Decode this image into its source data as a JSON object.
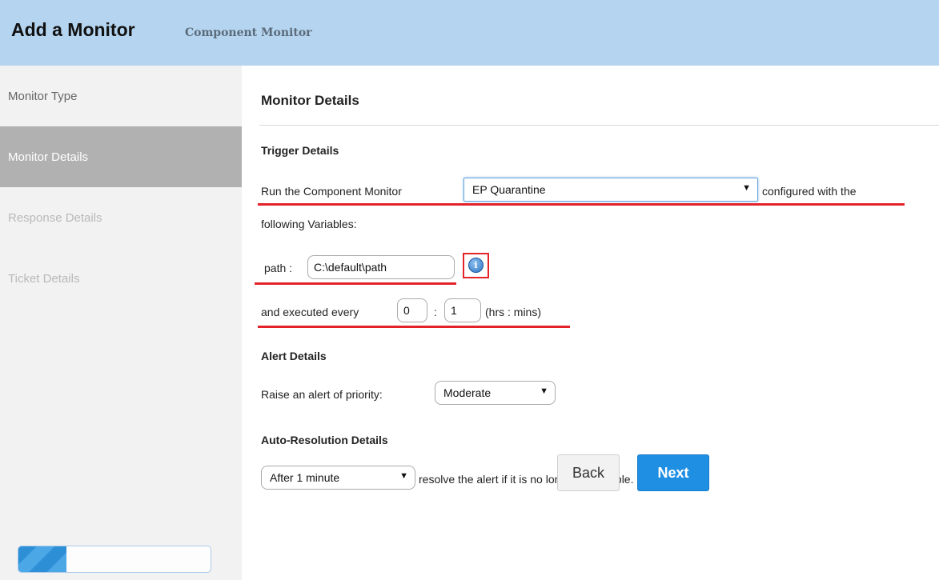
{
  "header": {
    "title": "Add a Monitor",
    "subtitle": "Component Monitor"
  },
  "sidebar": {
    "items": [
      {
        "label": "Monitor Type",
        "state": "done"
      },
      {
        "label": "Monitor Details",
        "state": "active"
      },
      {
        "label": "Response Details",
        "state": "pending"
      },
      {
        "label": "Ticket Details",
        "state": "pending"
      }
    ],
    "progress_fraction": 0.25
  },
  "main": {
    "title": "Monitor Details",
    "trigger": {
      "heading": "Trigger Details",
      "run_prefix": "Run the Component Monitor",
      "component_value": "EP Quarantine",
      "run_suffix": "configured with the",
      "run_line2": "following Variables:",
      "path_label": "path :",
      "path_value": "C:\\default\\path",
      "info_icon": "info-icon",
      "exec_prefix": "and executed every",
      "hours_value": "0",
      "colon": ":",
      "minutes_value": "1",
      "exec_suffix": "(hrs : mins)"
    },
    "alert": {
      "heading": "Alert Details",
      "label": "Raise an alert of priority:",
      "priority_value": "Moderate"
    },
    "auto_resolution": {
      "heading": "Auto-Resolution Details",
      "after_value": "After 1 minute",
      "suffix": "resolve the alert if it is no longer applicable."
    },
    "buttons": {
      "back": "Back",
      "next": "Next"
    }
  },
  "colors": {
    "header_bg": "#b4d4ef",
    "accent": "#1f8fe3",
    "annotation": "#e3222a"
  }
}
